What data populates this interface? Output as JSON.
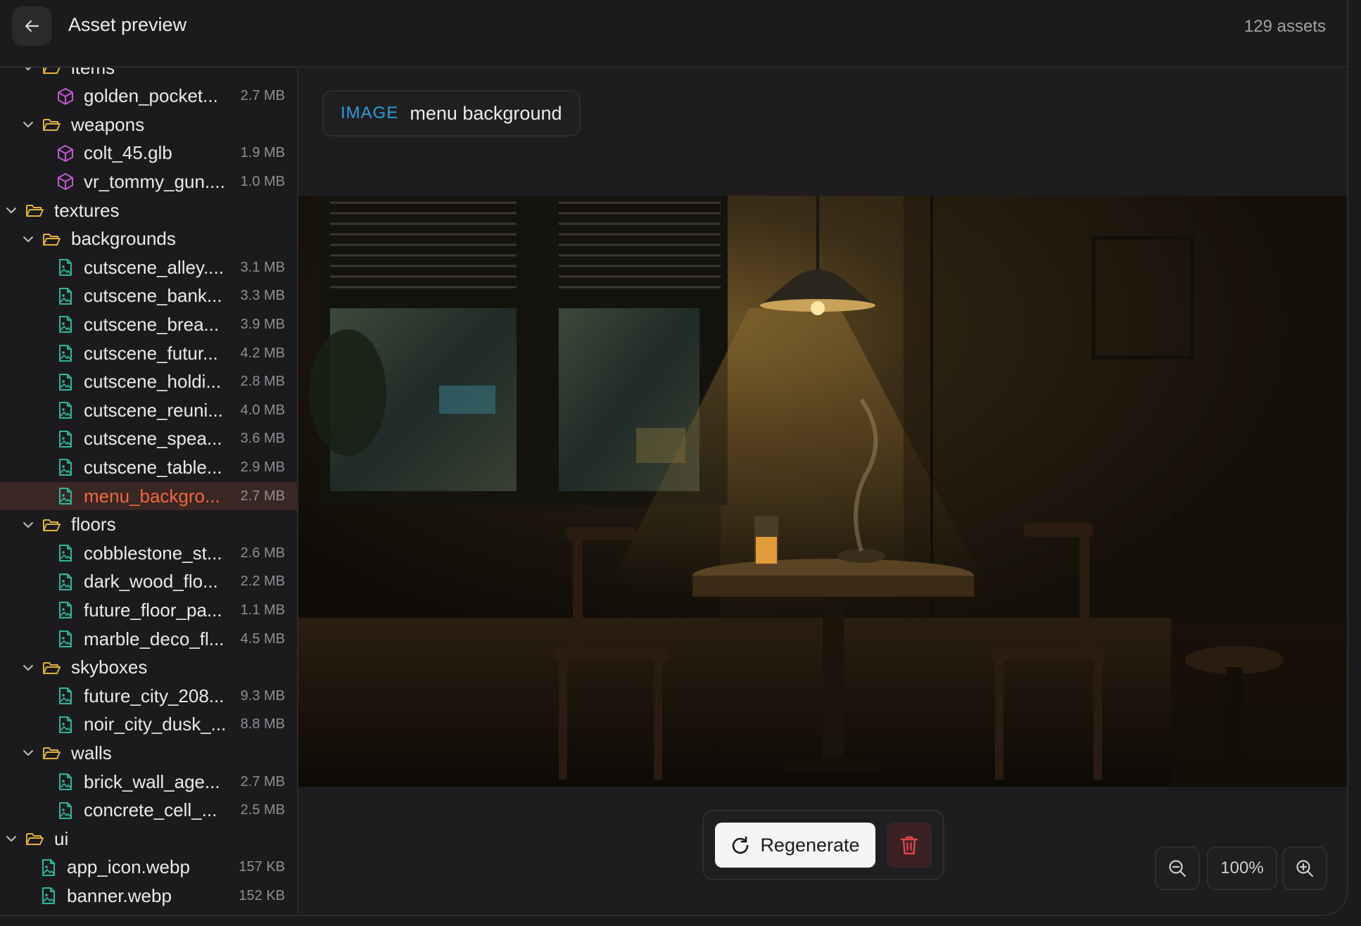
{
  "header": {
    "title": "Asset preview",
    "count": "129 assets"
  },
  "tree": [
    {
      "level": 1,
      "kind": "folder",
      "expanded": true,
      "name": "items",
      "size": ""
    },
    {
      "level": 2,
      "kind": "model",
      "name": "golden_pocket...",
      "size": "2.7 MB"
    },
    {
      "level": 1,
      "kind": "folder",
      "expanded": true,
      "name": "weapons",
      "size": ""
    },
    {
      "level": 2,
      "kind": "model",
      "name": "colt_45.glb",
      "size": "1.9 MB"
    },
    {
      "level": 2,
      "kind": "model",
      "name": "vr_tommy_gun....",
      "size": "1.0 MB"
    },
    {
      "level": 0,
      "kind": "folder",
      "expanded": true,
      "name": "textures",
      "size": ""
    },
    {
      "level": 1,
      "kind": "folder",
      "expanded": true,
      "name": "backgrounds",
      "size": ""
    },
    {
      "level": 2,
      "kind": "image",
      "name": "cutscene_alley....",
      "size": "3.1 MB"
    },
    {
      "level": 2,
      "kind": "image",
      "name": "cutscene_bank...",
      "size": "3.3 MB"
    },
    {
      "level": 2,
      "kind": "image",
      "name": "cutscene_brea...",
      "size": "3.9 MB"
    },
    {
      "level": 2,
      "kind": "image",
      "name": "cutscene_futur...",
      "size": "4.2 MB"
    },
    {
      "level": 2,
      "kind": "image",
      "name": "cutscene_holdi...",
      "size": "2.8 MB"
    },
    {
      "level": 2,
      "kind": "image",
      "name": "cutscene_reuni...",
      "size": "4.0 MB"
    },
    {
      "level": 2,
      "kind": "image",
      "name": "cutscene_spea...",
      "size": "3.6 MB"
    },
    {
      "level": 2,
      "kind": "image",
      "name": "cutscene_table...",
      "size": "2.9 MB"
    },
    {
      "level": 2,
      "kind": "image",
      "name": "menu_backgro...",
      "size": "2.7 MB",
      "selected": true
    },
    {
      "level": 1,
      "kind": "folder",
      "expanded": true,
      "name": "floors",
      "size": ""
    },
    {
      "level": 2,
      "kind": "image",
      "name": "cobblestone_st...",
      "size": "2.6 MB"
    },
    {
      "level": 2,
      "kind": "image",
      "name": "dark_wood_flo...",
      "size": "2.2 MB"
    },
    {
      "level": 2,
      "kind": "image",
      "name": "future_floor_pa...",
      "size": "1.1 MB"
    },
    {
      "level": 2,
      "kind": "image",
      "name": "marble_deco_fl...",
      "size": "4.5 MB"
    },
    {
      "level": 1,
      "kind": "folder",
      "expanded": true,
      "name": "skyboxes",
      "size": ""
    },
    {
      "level": 2,
      "kind": "image",
      "name": "future_city_208...",
      "size": "9.3 MB"
    },
    {
      "level": 2,
      "kind": "image",
      "name": "noir_city_dusk_...",
      "size": "8.8 MB"
    },
    {
      "level": 1,
      "kind": "folder",
      "expanded": true,
      "name": "walls",
      "size": ""
    },
    {
      "level": 2,
      "kind": "image",
      "name": "brick_wall_age...",
      "size": "2.7 MB"
    },
    {
      "level": 2,
      "kind": "image",
      "name": "concrete_cell_...",
      "size": "2.5 MB"
    },
    {
      "level": 0,
      "kind": "folder",
      "expanded": true,
      "name": "ui",
      "size": ""
    },
    {
      "level": 1,
      "kind": "image",
      "name": "app_icon.webp",
      "size": "157 KB"
    },
    {
      "level": 1,
      "kind": "image",
      "name": "banner.webp",
      "size": "152 KB"
    }
  ],
  "preview": {
    "type_label": "IMAGE",
    "asset_name": "menu background"
  },
  "actions": {
    "regenerate_label": "Regenerate"
  },
  "zoom": {
    "level": "100%"
  },
  "colors": {
    "accent_selected": "#f0683f",
    "type_label": "#2b9fd9",
    "folder_icon": "#e2b33b",
    "model_icon": "#c15ad6",
    "image_icon": "#2fb69a",
    "delete_icon": "#e0454a"
  }
}
